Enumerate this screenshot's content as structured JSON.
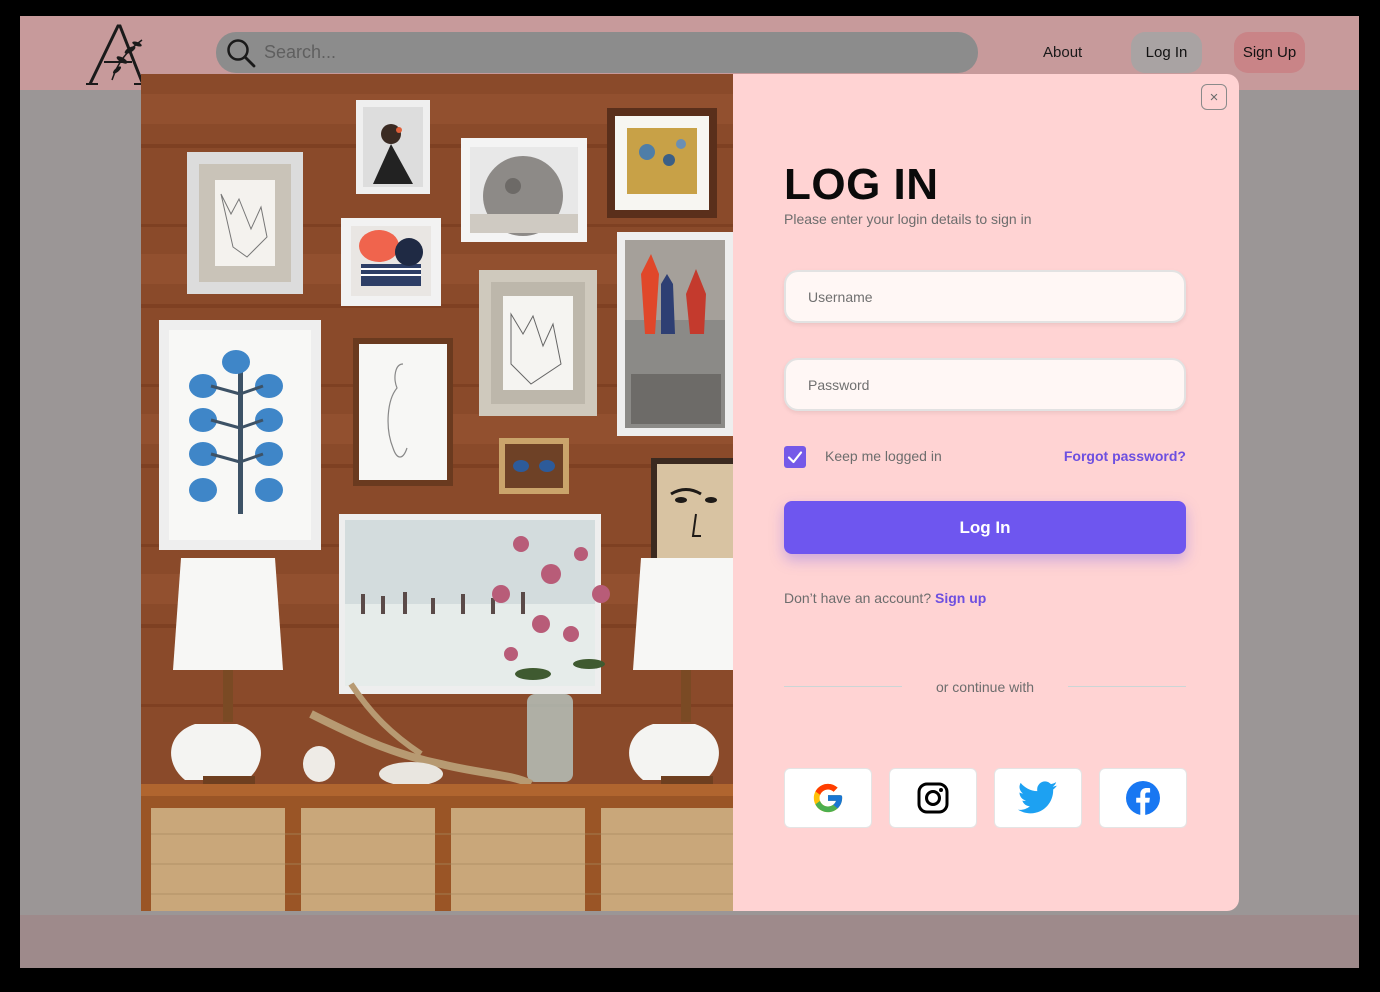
{
  "header": {
    "search_placeholder": "Search...",
    "about": "About",
    "login": "Log In",
    "signup": "Sign Up"
  },
  "login": {
    "title": "LOG IN",
    "subtitle": "Please enter your login details to sign in",
    "username_placeholder": "Username",
    "password_placeholder": "Password",
    "remember": "Keep me logged in",
    "remember_checked": true,
    "forgot": "Forgot password?",
    "submit": "Log In",
    "no_account": "Don’t have an account?",
    "signup_link": "Sign up",
    "divider": "or continue with",
    "close_icon": "×",
    "providers": [
      {
        "name": "Google",
        "icon": "google-icon"
      },
      {
        "name": "Instagram",
        "icon": "instagram-icon"
      },
      {
        "name": "Twitter",
        "icon": "twitter-icon"
      },
      {
        "name": "Facebook",
        "icon": "facebook-icon"
      }
    ]
  },
  "colors": {
    "accent": "#6e56ef",
    "panel": "#ffd3d3",
    "header": "#c79a9b"
  }
}
